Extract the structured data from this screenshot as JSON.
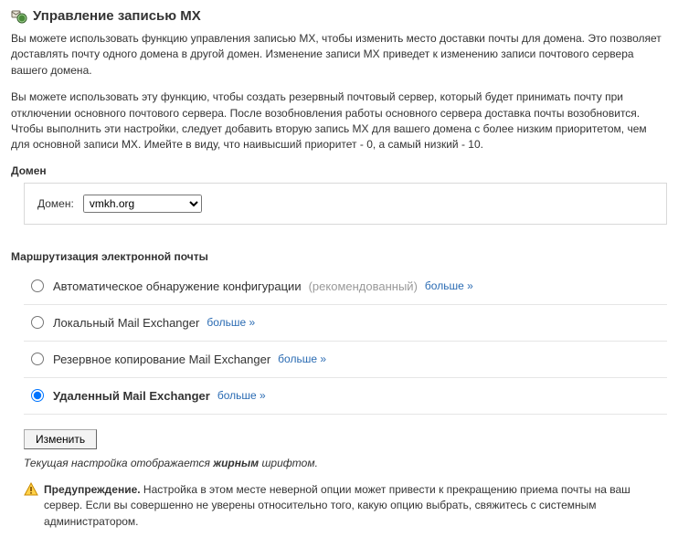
{
  "header": {
    "title": "Управление записью MX"
  },
  "intro": {
    "p1": "Вы можете использовать функцию управления записью MX, чтобы изменить место доставки почты для домена. Это позволяет доставлять почту одного домена в другой домен. Изменение записи MX приведет к изменению записи почтового сервера вашего домена.",
    "p2": "Вы можете использовать эту функцию, чтобы создать резервный почтовый сервер, который будет принимать почту при отключении основного почтового сервера. После возобновления работы основного сервера доставка почты возобновится. Чтобы выполнить эти настройки, следует добавить вторую запись MX для вашего домена с более низким приоритетом, чем для основной записи MX. Имейте в виду, что наивысший приоритет - 0, а самый низкий - 10."
  },
  "domain": {
    "section_label": "Домен",
    "field_label": "Домен:",
    "selected": "vmkh.org"
  },
  "routing": {
    "section_label": "Маршрутизация электронной почты",
    "more": "больше »",
    "options": {
      "auto": {
        "label": "Автоматическое обнаружение конфигурации",
        "suffix": "(рекомендованный)"
      },
      "local": {
        "label": "Локальный Mail Exchanger"
      },
      "backup": {
        "label": "Резервное копирование Mail Exchanger"
      },
      "remote": {
        "label": "Удаленный Mail Exchanger"
      }
    },
    "submit": "Изменить"
  },
  "note": {
    "pre": "Текущая настройка отображается ",
    "bold": "жирным",
    "post": " шрифтом."
  },
  "warning": {
    "bold": "Предупреждение.",
    "text": " Настройка в этом месте неверной опции может привести к прекращению приема почты на ваш сервер. Если вы совершенно не уверены относительно того, какую опцию выбрать, свяжитесь с системным администратором."
  }
}
